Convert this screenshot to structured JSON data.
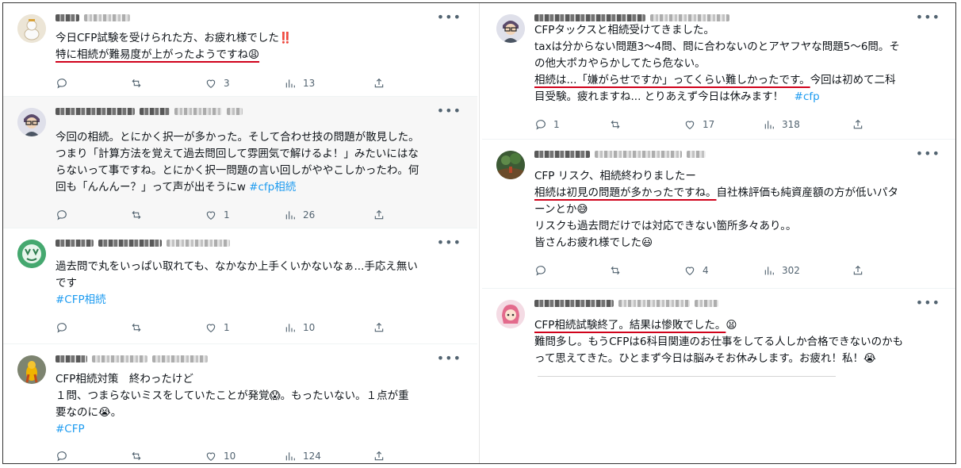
{
  "left": [
    {
      "lines": [
        {
          "parts": [
            {
              "t": "今日CFP試験を受けられた方、お疲れ様でした‼️"
            }
          ]
        },
        {
          "parts": [
            {
              "t": "特に相続が難易度が上がったようですね😩",
              "u": true
            }
          ]
        }
      ],
      "replies": "",
      "retweets": "",
      "likes": "3",
      "views": "13"
    },
    {
      "lines": [
        {
          "parts": [
            {
              "t": "今回の相続。とにかく択一が多かった。そして合わせ技の問題が散見した。"
            }
          ]
        },
        {
          "parts": [
            {
              "t": "つまり「計算方法を覚えて過去問回して雰囲気で解けるよ！」みたいにはな"
            }
          ]
        },
        {
          "parts": [
            {
              "t": "らないって事ですね。とにかく択一問題の言い回しがややこしかったわ。何"
            }
          ]
        },
        {
          "parts": [
            {
              "t": "回も「んんんー？」って声が出そうにw "
            },
            {
              "t": "#cfp相続",
              "tag": true
            }
          ]
        }
      ],
      "replies": "",
      "retweets": "",
      "likes": "1",
      "views": "26"
    },
    {
      "lines": [
        {
          "parts": [
            {
              "t": "過去問で丸をいっぱい取れても、なかなか上手くいかないなぁ...手応え無い"
            }
          ]
        },
        {
          "parts": [
            {
              "t": "です"
            }
          ]
        },
        {
          "parts": [
            {
              "t": "#CFP相続",
              "tag": true
            }
          ]
        }
      ],
      "replies": "",
      "retweets": "",
      "likes": "1",
      "views": "10"
    },
    {
      "lines": [
        {
          "parts": [
            {
              "t": "CFP相続対策　終わったけど"
            }
          ]
        },
        {
          "parts": [
            {
              "t": "１問、つまらないミスをしていたことが発覚😱。もったいない。１点が重"
            }
          ]
        },
        {
          "parts": [
            {
              "t": "要なのに😭。"
            }
          ]
        },
        {
          "parts": [
            {
              "t": "#CFP",
              "tag": true
            }
          ]
        }
      ],
      "replies": "",
      "retweets": "",
      "likes": "10",
      "views": "124"
    }
  ],
  "right": [
    {
      "lines": [
        {
          "parts": [
            {
              "t": "CFPタックスと相続受けてきました。"
            }
          ]
        },
        {
          "parts": [
            {
              "t": "taxは分からない問題3〜4問、問に合わないのとアヤフヤな問題5〜6問。そ"
            }
          ]
        },
        {
          "parts": [
            {
              "t": "の他大ポカやらかしてたら危ない。"
            }
          ]
        },
        {
          "parts": [
            {
              "t": "相続は...「嫌がらせですか」ってくらい難しかったです。",
              "u": true
            },
            {
              "t": "今回は初めて二科"
            }
          ]
        },
        {
          "parts": [
            {
              "t": "目受験。疲れますね... とりあえず今日は休みます！　"
            },
            {
              "t": "#cfp",
              "tag": true
            }
          ]
        }
      ],
      "replies": "1",
      "retweets": "",
      "likes": "17",
      "views": "318"
    },
    {
      "lines": [
        {
          "parts": [
            {
              "t": "CFP リスク、相続終わりましたー"
            }
          ]
        },
        {
          "parts": [
            {
              "t": "相続は初見の問題が多かったですね。",
              "u": true
            },
            {
              "t": "自社株評価も純資産額の方が低いパタ"
            }
          ]
        },
        {
          "parts": [
            {
              "t": "ーンとか😅"
            }
          ]
        },
        {
          "parts": [
            {
              "t": "リスクも過去問だけでは対応できない箇所多々あり。。"
            }
          ]
        },
        {
          "parts": [
            {
              "t": "皆さんお疲れ様でした😃"
            }
          ]
        }
      ],
      "replies": "",
      "retweets": "",
      "likes": "4",
      "views": "302"
    },
    {
      "lines": [
        {
          "parts": [
            {
              "t": "CFP相続試験終了。結果は惨敗でした。",
              "u": true
            },
            {
              "t": "😫"
            }
          ]
        },
        {
          "parts": [
            {
              "t": "難問多し。もうCFPは6科目関連のお仕事をしてる人しか合格できないのかも"
            }
          ]
        },
        {
          "parts": [
            {
              "t": "って思えてきた。ひとまず今日は脳みそお休みします。お疲れ！私！😭"
            }
          ]
        }
      ],
      "replies": "",
      "retweets": "",
      "likes": "",
      "views": ""
    }
  ],
  "icons": {
    "reply": "reply-icon",
    "retweet": "retweet-icon",
    "like": "heart-icon",
    "views": "views-icon",
    "share": "share-icon",
    "more": "more-icon"
  },
  "colors": {
    "hashtag": "#1d9bf0",
    "underline": "#d0021b",
    "muted": "#536471"
  }
}
